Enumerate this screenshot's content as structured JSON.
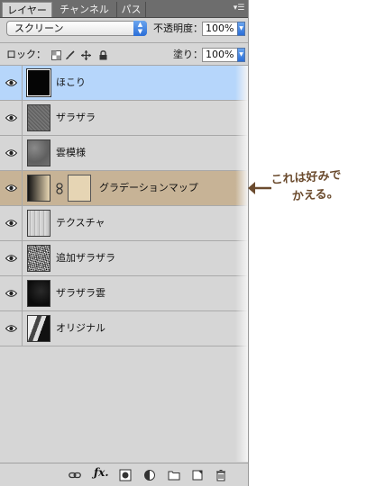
{
  "tabs": [
    {
      "label": "レイヤー",
      "active": true
    },
    {
      "label": "チャンネル",
      "active": false
    },
    {
      "label": "パス",
      "active": false
    }
  ],
  "blend": {
    "mode": "スクリーン"
  },
  "opacity": {
    "label": "不透明度：",
    "value": "100%"
  },
  "lock": {
    "label": "ロック："
  },
  "fill": {
    "label": "塗り：",
    "value": "100%"
  },
  "layers": [
    {
      "name": "ほこり",
      "selected": true
    },
    {
      "name": "ザラザラ",
      "selected": false
    },
    {
      "name": "雲模様",
      "selected": false
    },
    {
      "name": "グラデーションマップ",
      "selected": false
    },
    {
      "name": "テクスチャ",
      "selected": false
    },
    {
      "name": "追加ザラザラ",
      "selected": false
    },
    {
      "name": "ザラザラ雲",
      "selected": false
    },
    {
      "name": "オリジナル",
      "selected": false
    }
  ],
  "annotation": {
    "line1": "これは好みで",
    "line2": "かえる。",
    "color": "#6b4b2e",
    "highlight": "#c7b396"
  },
  "colors": {
    "panel": "#d6d6d6",
    "selection": "#b6d6fb",
    "tabbar": "#6d6d6d"
  }
}
